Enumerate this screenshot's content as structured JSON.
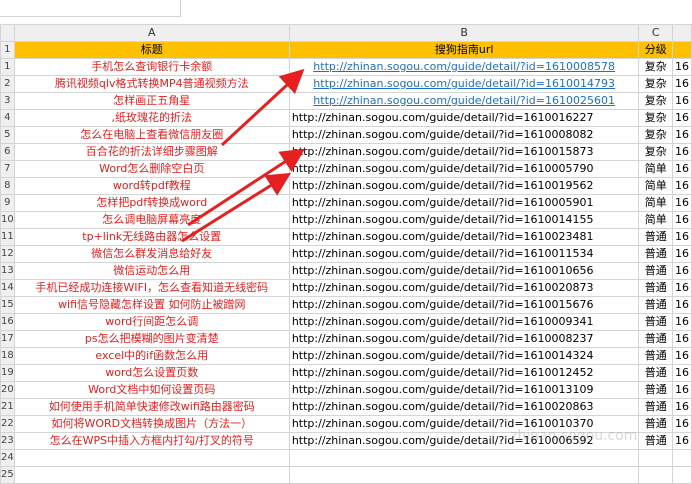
{
  "columns": [
    "A",
    "B",
    "C"
  ],
  "header": {
    "title": "标题",
    "url": "搜狗指南url",
    "level": "分级"
  },
  "rows": [
    {
      "num": "1",
      "title": "手机怎么查询银行卡余额",
      "url": "http://zhinan.sogou.com/guide/detail/?id=1610008578",
      "level": "复杂",
      "extra": "16",
      "link": true
    },
    {
      "num": "2",
      "title": "腾讯视频qlv格式转换MP4普通视频方法",
      "url": "http://zhinan.sogou.com/guide/detail/?id=1610014793",
      "level": "复杂",
      "extra": "16",
      "link": true
    },
    {
      "num": "3",
      "title": "怎样画正五角星",
      "url": "http://zhinan.sogou.com/guide/detail/?id=1610025601",
      "level": "复杂",
      "extra": "16",
      "link": true
    },
    {
      "num": "4",
      "title": ",纸玫瑰花的折法",
      "url": "http://zhinan.sogou.com/guide/detail/?id=1610016227",
      "level": "复杂",
      "extra": "16",
      "link": false
    },
    {
      "num": "5",
      "title": "怎么在电脑上查看微信朋友圈",
      "url": "http://zhinan.sogou.com/guide/detail/?id=1610008082",
      "level": "复杂",
      "extra": "16",
      "link": false
    },
    {
      "num": "6",
      "title": "百合花的折法详细步骤图解",
      "url": "http://zhinan.sogou.com/guide/detail/?id=1610015873",
      "level": "复杂",
      "extra": "16",
      "link": false
    },
    {
      "num": "7",
      "title": "Word怎么删除空白页",
      "url": "http://zhinan.sogou.com/guide/detail/?id=1610005790",
      "level": "简单",
      "extra": "16",
      "link": false
    },
    {
      "num": "8",
      "title": "word转pdf教程",
      "url": "http://zhinan.sogou.com/guide/detail/?id=1610019562",
      "level": "简单",
      "extra": "16",
      "link": false
    },
    {
      "num": "9",
      "title": "怎样把pdf转换成word",
      "url": "http://zhinan.sogou.com/guide/detail/?id=1610005901",
      "level": "简单",
      "extra": "16",
      "link": false
    },
    {
      "num": "10",
      "title": "怎么调电脑屏幕亮度",
      "url": "http://zhinan.sogou.com/guide/detail/?id=1610014155",
      "level": "简单",
      "extra": "16",
      "link": false
    },
    {
      "num": "11",
      "title": "tp+link无线路由器怎么设置",
      "url": "http://zhinan.sogou.com/guide/detail/?id=1610023481",
      "level": "普通",
      "extra": "16",
      "link": false
    },
    {
      "num": "12",
      "title": "微信怎么群发消息给好友",
      "url": "http://zhinan.sogou.com/guide/detail/?id=1610011534",
      "level": "普通",
      "extra": "16",
      "link": false
    },
    {
      "num": "13",
      "title": "微信运动怎么用",
      "url": "http://zhinan.sogou.com/guide/detail/?id=1610010656",
      "level": "普通",
      "extra": "16",
      "link": false
    },
    {
      "num": "14",
      "title": "手机已经成功连接WIFI，怎么查看知道无线密码",
      "url": "http://zhinan.sogou.com/guide/detail/?id=1610020873",
      "level": "普通",
      "extra": "16",
      "link": false
    },
    {
      "num": "15",
      "title": "wifi信号隐藏怎样设置 如何防止被蹭网",
      "url": "http://zhinan.sogou.com/guide/detail/?id=1610015676",
      "level": "普通",
      "extra": "16",
      "link": false
    },
    {
      "num": "16",
      "title": "word行间距怎么调",
      "url": "http://zhinan.sogou.com/guide/detail/?id=1610009341",
      "level": "普通",
      "extra": "16",
      "link": false
    },
    {
      "num": "17",
      "title": "ps怎么把模糊的图片变清楚",
      "url": "http://zhinan.sogou.com/guide/detail/?id=1610008237",
      "level": "普通",
      "extra": "16",
      "link": false
    },
    {
      "num": "18",
      "title": "excel中的if函数怎么用",
      "url": "http://zhinan.sogou.com/guide/detail/?id=1610014324",
      "level": "普通",
      "extra": "16",
      "link": false
    },
    {
      "num": "19",
      "title": "word怎么设置页数",
      "url": "http://zhinan.sogou.com/guide/detail/?id=1610012452",
      "level": "普通",
      "extra": "16",
      "link": false
    },
    {
      "num": "20",
      "title": "Word文档中如何设置页码",
      "url": "http://zhinan.sogou.com/guide/detail/?id=1610013109",
      "level": "普通",
      "extra": "16",
      "link": false
    },
    {
      "num": "21",
      "title": "如何使用手机简单快速修改wifi路由器密码",
      "url": "http://zhinan.sogou.com/guide/detail/?id=1610020863",
      "level": "普通",
      "extra": "16",
      "link": false
    },
    {
      "num": "22",
      "title": "如何将WORD文档转换成图片（方法一）",
      "url": "http://zhinan.sogou.com/guide/detail/?id=1610010370",
      "level": "普通",
      "extra": "16",
      "link": false
    },
    {
      "num": "23",
      "title": "怎么在WPS中插入方框内打勾/打叉的符号",
      "url": "http://zhinan.sogou.com/guide/detail/?id=1610006592",
      "level": "普通",
      "extra": "16",
      "link": false
    }
  ],
  "empty_rows": [
    "24",
    "25"
  ],
  "header_row_num": "1",
  "watermark": "zhinan.sogou.com",
  "colors": {
    "header_bg": "#ffc000",
    "title_text": "#e02020",
    "link_text": "#1f6fc5",
    "arrow": "#e52020"
  }
}
